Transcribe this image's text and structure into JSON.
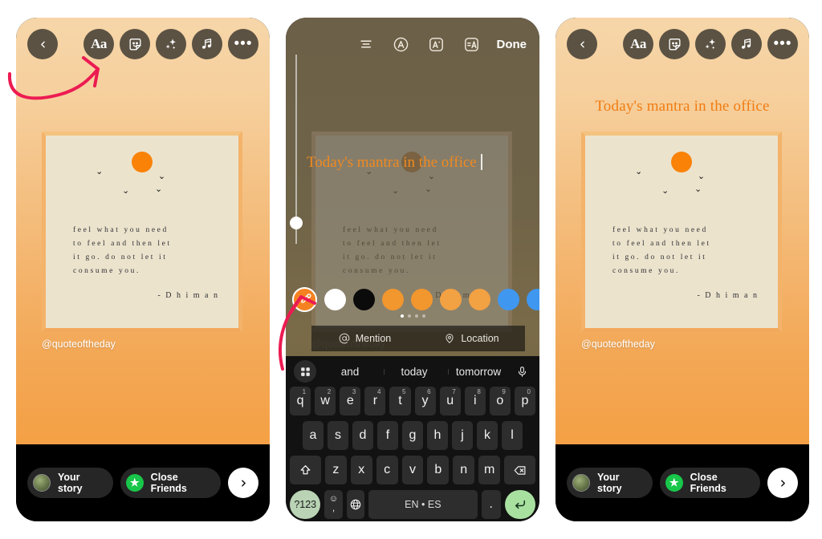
{
  "toolbar": {
    "back_icon": "chevron-left-icon",
    "items": [
      {
        "name": "text-tool",
        "label": "Aa",
        "icon": "text-aa-icon"
      },
      {
        "name": "sticker-tool",
        "label": "",
        "icon": "sticker-icon"
      },
      {
        "name": "effects-tool",
        "label": "",
        "icon": "sparkles-icon"
      },
      {
        "name": "music-tool",
        "label": "",
        "icon": "music-note-icon"
      },
      {
        "name": "more-tool",
        "label": "",
        "icon": "more-horizontal-icon"
      }
    ]
  },
  "quote_card": {
    "lines": [
      "feel what you need",
      "to feel and then let",
      "it go. do not let it",
      "consume you."
    ],
    "author": "- D h i m a n",
    "sun_color": "#f98207",
    "card_bg": "#ece3cd",
    "border_color": "#f3b36a"
  },
  "handle": "@quoteoftheday",
  "headline": "Today's mantra in the office",
  "headline_color": "#f07c12",
  "share_bar": {
    "your_story": "Your story",
    "close_friends": "Close Friends",
    "next_icon": "chevron-right-icon"
  },
  "editor": {
    "toolbar": [
      {
        "name": "align-text-button",
        "icon": "align-center-icon"
      },
      {
        "name": "text-style-button",
        "icon": "circled-a-icon"
      },
      {
        "name": "text-animation-button",
        "icon": "a-sparkle-icon"
      },
      {
        "name": "text-highlight-button",
        "icon": "a-bar-icon"
      }
    ],
    "done_label": "Done",
    "text_value": "Today's mantra in the office",
    "font_size_slider": {
      "name": "font-size-slider",
      "thumb_position_pct": 86
    },
    "colors": [
      {
        "name": "eyedropper",
        "hex": "#f58220"
      },
      {
        "name": "white",
        "hex": "#ffffff"
      },
      {
        "name": "black",
        "hex": "#0b0b0b"
      },
      {
        "name": "orange-1",
        "hex": "#f2962e"
      },
      {
        "name": "orange-2",
        "hex": "#f2962e"
      },
      {
        "name": "orange-3",
        "hex": "#f2a143"
      },
      {
        "name": "orange-4",
        "hex": "#f2a143"
      },
      {
        "name": "blue-1",
        "hex": "#3f97f0"
      },
      {
        "name": "blue-2",
        "hex": "#3f97f0"
      },
      {
        "name": "blue-3",
        "hex": "#4a9cf2"
      }
    ],
    "page_dots": {
      "total": 4,
      "active": 0
    },
    "mention_label": "Mention",
    "location_label": "Location"
  },
  "keyboard": {
    "suggestions": [
      "and",
      "today",
      "tomorrow"
    ],
    "grid_icon": "keyboard-grid-icon",
    "mic_icon": "microphone-icon",
    "row1": [
      {
        "k": "q",
        "n": "1"
      },
      {
        "k": "w",
        "n": "2"
      },
      {
        "k": "e",
        "n": "3"
      },
      {
        "k": "r",
        "n": "4"
      },
      {
        "k": "t",
        "n": "5"
      },
      {
        "k": "y",
        "n": "6"
      },
      {
        "k": "u",
        "n": "7"
      },
      {
        "k": "i",
        "n": "8"
      },
      {
        "k": "o",
        "n": "9"
      },
      {
        "k": "p",
        "n": "0"
      }
    ],
    "row2": [
      "a",
      "s",
      "d",
      "f",
      "g",
      "h",
      "j",
      "k",
      "l"
    ],
    "row3": [
      "z",
      "x",
      "c",
      "v",
      "b",
      "n",
      "m"
    ],
    "shift_icon": "shift-up-icon",
    "backspace_icon": "backspace-icon",
    "sym_label": "?123",
    "emoji_label": "☺",
    "comma_label": ",",
    "globe_icon": "globe-icon",
    "space_label": "EN • ES",
    "dot_label": ".",
    "enter_icon": "enter-return-icon"
  },
  "annotations": {
    "arrow_color": "#ec1b52",
    "arrow1_target": "text-tool",
    "arrow2_target": "eyedropper"
  }
}
